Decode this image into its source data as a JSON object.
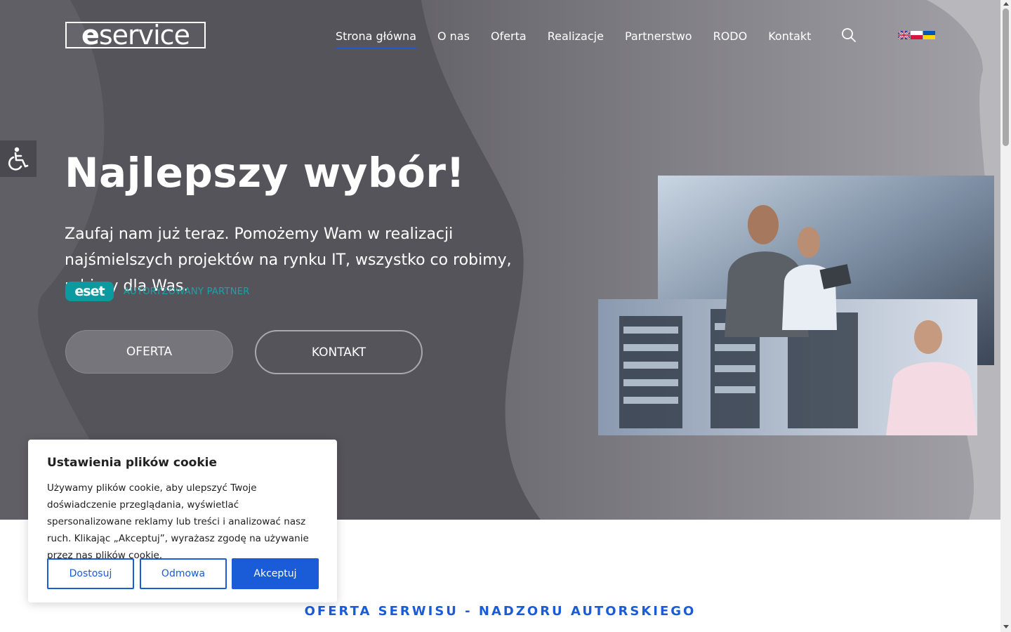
{
  "header": {
    "logo_text_a": "e",
    "logo_text_b": "service",
    "nav": [
      {
        "label": "Strona główna"
      },
      {
        "label": "O nas"
      },
      {
        "label": "Oferta"
      },
      {
        "label": "Realizacje"
      },
      {
        "label": "Partnerstwo"
      },
      {
        "label": "RODO"
      },
      {
        "label": "Kontakt"
      }
    ],
    "active_nav": "Strona główna",
    "icons": {
      "search": "search-icon",
      "languages": [
        "flag-en-icon",
        "flag-pl-icon",
        "flag-ua-icon"
      ]
    }
  },
  "accessibility": {
    "icon": "accessibility-icon"
  },
  "hero": {
    "title": "Najlepszy wybór!",
    "subtitle": "Zaufaj nam już teraz. Pomożemy Wam w realizacji najśmielszych projektów na rynku IT, wszystko co robimy, robimy dla Was.",
    "partner_logo": "eset",
    "partner_label": "AUTORYZOWANY PARTNER",
    "btn_oferta": "OFERTA",
    "btn_kontakt": "KONTAKT"
  },
  "section": {
    "heading": "OFERTA SERWISU - NADZORU AUTORSKIEGO"
  },
  "cookie": {
    "title": "Ustawienia plików cookie",
    "text": "Używamy plików cookie, aby ulepszyć Twoje doświadczenie przeglądania, wyświetlać spersonalizowane reklamy lub treści i analizować nasz ruch. Klikając „Akceptuj”, wyrażasz zgodę na używanie przez nas plików cookie.",
    "btn_customize": "Dostosuj",
    "btn_reject": "Odmowa",
    "btn_accept": "Akceptuj"
  },
  "colors": {
    "accent": "#1a5cd8",
    "hero_bg": "#5a5860",
    "eset": "#0a9a9f"
  }
}
